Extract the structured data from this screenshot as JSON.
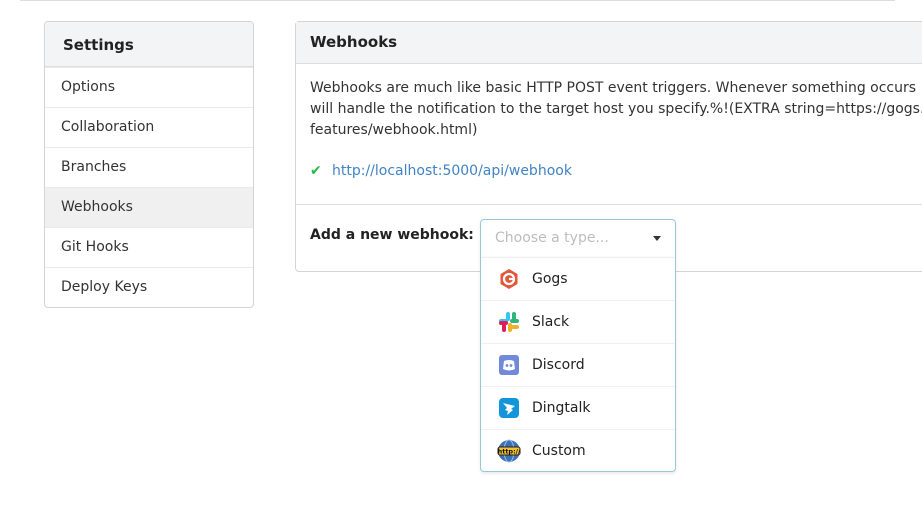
{
  "sidebar": {
    "title": "Settings",
    "items": [
      {
        "label": "Options"
      },
      {
        "label": "Collaboration"
      },
      {
        "label": "Branches"
      },
      {
        "label": "Webhooks"
      },
      {
        "label": "Git Hooks"
      },
      {
        "label": "Deploy Keys"
      }
    ],
    "active": "Webhooks"
  },
  "panel": {
    "title": "Webhooks",
    "description": "Webhooks are much like basic HTTP POST event triggers. Whenever something occurs\nwill handle the notification to the target host you specify.%!(EXTRA string=https://gogs.\nfeatures/webhook.html)",
    "hook_url": "http://localhost:5000/api/webhook",
    "status_icon": "check-icon",
    "add_label": "Add a new webhook:"
  },
  "dropdown": {
    "placeholder": "Choose a type...",
    "options": [
      {
        "label": "Gogs",
        "icon": "gogs-icon"
      },
      {
        "label": "Slack",
        "icon": "slack-icon"
      },
      {
        "label": "Discord",
        "icon": "discord-icon"
      },
      {
        "label": "Dingtalk",
        "icon": "dingtalk-icon"
      },
      {
        "label": "Custom",
        "icon": "http-icon"
      }
    ]
  },
  "colors": {
    "link": "#4183c4",
    "check": "#21ba45",
    "dropdown_border": "#96c8da"
  }
}
